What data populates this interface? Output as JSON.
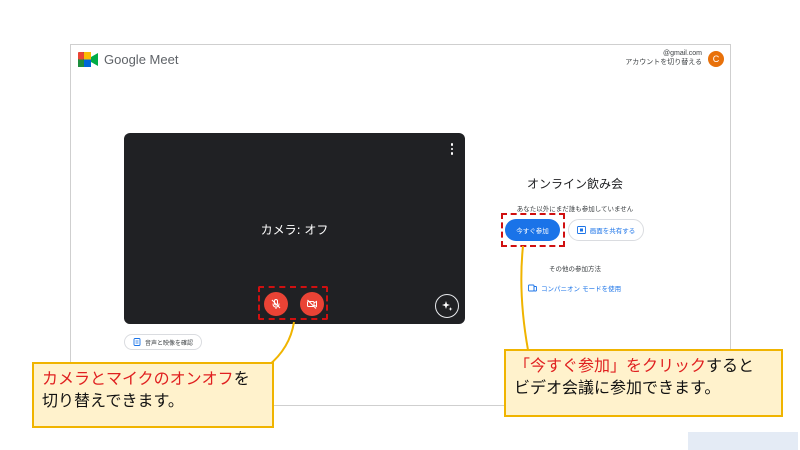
{
  "app": {
    "logo_text": "Google Meet"
  },
  "account": {
    "email": "　　　　@gmail.com",
    "switch_label": "アカウントを切り替える",
    "avatar_letter": "C"
  },
  "preview": {
    "camera_status": "カメラ: オフ"
  },
  "audio_video_check_label": "音声と映像を確認",
  "join_panel": {
    "meeting_title": "オンライン飲み会",
    "nobody_here_text": "あなた以外にまだ誰も参加していません",
    "join_button_label": "今すぐ参加",
    "share_screen_label": "画面を共有する",
    "other_ways_label": "その他の参加方法",
    "companion_mode_label": "コンパニオン モードを使用"
  },
  "callouts": {
    "left": {
      "highlight": "カメラとマイクのオンオフ",
      "rest_line1": "を",
      "line2": "切り替えできます。"
    },
    "right": {
      "highlight": "「今すぐ参加」をクリック",
      "rest_line1": "すると",
      "line2": "ビデオ会議に参加できます。"
    }
  },
  "colors": {
    "accent_blue": "#1a73e8",
    "control_red": "#ea4335",
    "highlight_red": "#d01010",
    "callout_fill": "#fff2cc",
    "callout_border": "#f0b400"
  },
  "icons": [
    "meet-logo-icon",
    "more-vert-icon",
    "visual-effects-icon",
    "mic-off-icon",
    "camera-off-icon",
    "audio-video-check-icon",
    "present-screen-icon",
    "companion-mode-icon"
  ]
}
